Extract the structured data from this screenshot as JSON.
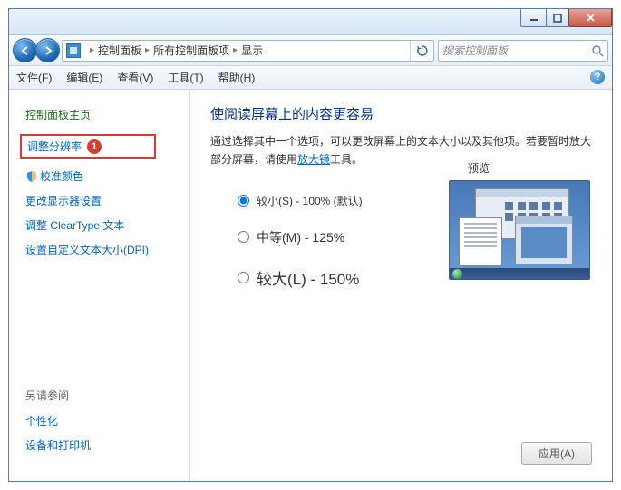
{
  "crumbs": {
    "items": [
      "控制面板",
      "所有控制面板项",
      "显示"
    ]
  },
  "search": {
    "placeholder": "搜索控制面板"
  },
  "menu": {
    "file": "文件(F)",
    "edit": "编辑(E)",
    "view": "查看(V)",
    "tools": "工具(T)",
    "help": "帮助(H)"
  },
  "sidebar": {
    "home": "控制面板主页",
    "resolution": "调整分辨率",
    "annotation": "1",
    "calibrate": "校准颜色",
    "displaySettings": "更改显示器设置",
    "cleartype": "调整 ClearType 文本",
    "customDpi": "设置自定义文本大小(DPI)",
    "seeAlso": "另请参阅",
    "personalize": "个性化",
    "devices": "设备和打印机"
  },
  "content": {
    "title": "使阅读屏幕上的内容更容易",
    "desc1": "通过选择其中一个选项，可以更改屏幕上的文本大小以及其他项。若要暂时放大部分屏幕，请使用",
    "magnifier": "放大镜",
    "desc2": "工具。",
    "opt_small": "较小(S) - 100% (默认)",
    "opt_medium": "中等(M) - 125%",
    "opt_large": "较大(L) - 150%",
    "preview": "预览",
    "apply": "应用(A)"
  }
}
